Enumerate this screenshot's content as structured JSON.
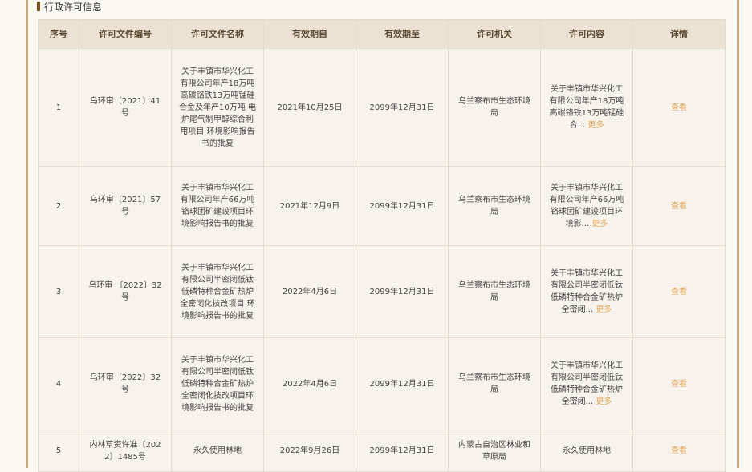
{
  "section": {
    "title": "行政许可信息"
  },
  "colors": {
    "accent": "#e0a45a",
    "frame": "#c7a97b",
    "header_bg": "#ebe2d3"
  },
  "table": {
    "headers": [
      "序号",
      "许可文件编号",
      "许可文件名称",
      "有效期自",
      "有效期至",
      "许可机关",
      "许可内容",
      "详情"
    ],
    "rows": [
      {
        "index": "1",
        "doc_no": "乌环审〔2021〕41号",
        "doc_name": "关于丰镇市华兴化工有限公司年产18万吨高碳铬铁13万吨锰硅合金及年产10万吨 电炉尾气制甲醇综合利用项目 环境影响报告书的批复",
        "valid_from": "2021年10月25日",
        "valid_to": "2099年12月31日",
        "authority": "乌兰察布市生态环境局",
        "content": "关于丰镇市华兴化工有限公司年产18万吨高碳铬铁13万吨锰硅合...",
        "more": "更多",
        "detail": "查看"
      },
      {
        "index": "2",
        "doc_no": "乌环审〔2021〕57号",
        "doc_name": "关于丰镇市华兴化工有限公司年产66万吨铬球团矿建设项目环境影响报告书的批复",
        "valid_from": "2021年12月9日",
        "valid_to": "2099年12月31日",
        "authority": "乌兰察布市生态环境局",
        "content": "关于丰镇市华兴化工有限公司年产66万吨铬球团矿建设项目环境影...",
        "more": "更多",
        "detail": "查看"
      },
      {
        "index": "3",
        "doc_no": "乌环审 〔2022〕32号",
        "doc_name": "关于丰镇市华兴化工有限公司半密闭低钛低磷特种合金矿热炉全密闭化技改项目 环境影响报告书的批复",
        "valid_from": "2022年4月6日",
        "valid_to": "2099年12月31日",
        "authority": "乌兰察布市生态环境局",
        "content": "关于丰镇市华兴化工有限公司半密闭低钛低磷特种合金矿热炉全密闭...",
        "more": "更多",
        "detail": "查看"
      },
      {
        "index": "4",
        "doc_no": "乌环审〔2022〕32号",
        "doc_name": "关于丰镇市华兴化工有限公司半密闭低钛低磷特种合金矿热炉全密闭化技改项目环境影响报告书的批复",
        "valid_from": "2022年4月6日",
        "valid_to": "2099年12月31日",
        "authority": "乌兰察布市生态环境局",
        "content": "关于丰镇市华兴化工有限公司半密闭低钛低磷特种合金矿热炉全密闭...",
        "more": "更多",
        "detail": "查看"
      },
      {
        "index": "5",
        "doc_no": "内林草资许准〔2022〕1485号",
        "doc_name": "永久使用林地",
        "valid_from": "2022年9月26日",
        "valid_to": "2099年12月31日",
        "authority": "内蒙古自治区林业和草原局",
        "content": "永久使用林地",
        "more": "",
        "detail": "查看"
      }
    ]
  }
}
